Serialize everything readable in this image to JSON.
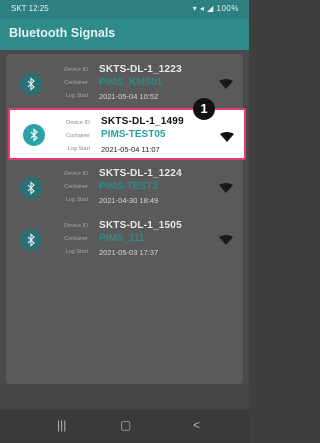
{
  "status": {
    "carrier": "SKT",
    "time": "12:25",
    "battery": "100%"
  },
  "app": {
    "title": "Bluetooth Signals"
  },
  "labels": {
    "device_id": "Device ID",
    "container": "Container",
    "log_start": "Log Start"
  },
  "devices": [
    {
      "device_id": "SKTS-DL-1_1223",
      "container": "PIMS_KMS01",
      "log_start": "2021-05-04 10:52"
    },
    {
      "device_id": "SKTS-DL-1_1499",
      "container": "PIMS-TEST05",
      "log_start": "2021-05-04 11:07"
    },
    {
      "device_id": "SKTS-DL-1_1224",
      "container": "PIMS-TEST3",
      "log_start": "2021-04-30 18:49"
    },
    {
      "device_id": "SKTS-DL-1_1505",
      "container": "PIMS_111",
      "log_start": "2021-05-03 17:37"
    }
  ],
  "callout": {
    "number": "1"
  },
  "nav": {
    "recents": "|||",
    "home": "▢",
    "back": "<"
  },
  "colors": {
    "primary": "#2f8a8a",
    "highlight_border": "#e53b6e"
  }
}
